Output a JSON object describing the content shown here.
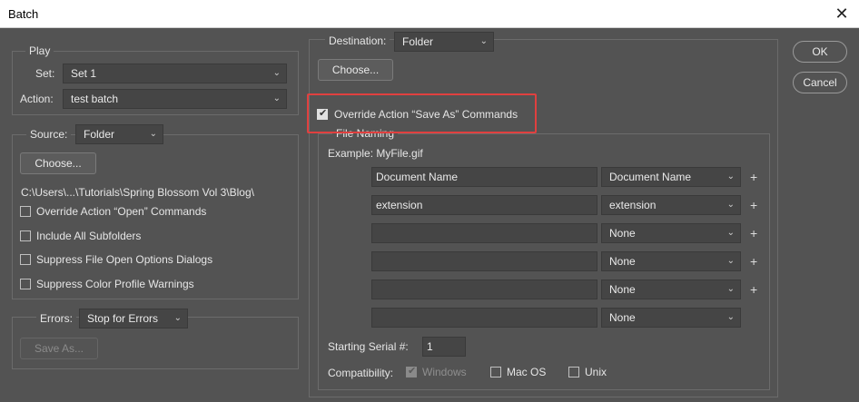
{
  "window": {
    "title": "Batch",
    "close_glyph": "✕"
  },
  "buttons": {
    "ok": "OK",
    "cancel": "Cancel"
  },
  "play": {
    "legend": "Play",
    "set_label": "Set:",
    "set_value": "Set 1",
    "action_label": "Action:",
    "action_value": "test batch"
  },
  "source": {
    "label": "Source:",
    "value": "Folder",
    "choose": "Choose...",
    "path": "C:\\Users\\...\\Tutorials\\Spring Blossom Vol 3\\Blog\\",
    "options": [
      {
        "label": "Override Action “Open” Commands",
        "checked": false
      },
      {
        "label": "Include All Subfolders",
        "checked": false
      },
      {
        "label": "Suppress File Open Options Dialogs",
        "checked": false
      },
      {
        "label": "Suppress Color Profile Warnings",
        "checked": false
      }
    ]
  },
  "errors": {
    "label": "Errors:",
    "value": "Stop for Errors",
    "save_as": "Save As..."
  },
  "destination": {
    "label": "Destination:",
    "value": "Folder",
    "choose": "Choose...",
    "override_label": "Override Action “Save As” Commands",
    "override_checked": true
  },
  "file_naming": {
    "legend": "File Naming",
    "example": "Example: MyFile.gif",
    "rows": [
      {
        "text": "Document Name",
        "select": "Document Name",
        "plus": "+"
      },
      {
        "text": "extension",
        "select": "extension",
        "plus": "+"
      },
      {
        "text": "",
        "select": "None",
        "plus": "+"
      },
      {
        "text": "",
        "select": "None",
        "plus": "+"
      },
      {
        "text": "",
        "select": "None",
        "plus": "+"
      },
      {
        "text": "",
        "select": "None",
        "plus": ""
      }
    ],
    "serial_label": "Starting Serial #:",
    "serial_value": "1",
    "compat_label": "Compatibility:",
    "compat": [
      {
        "label": "Windows",
        "checked": true,
        "disabled": true
      },
      {
        "label": "Mac OS",
        "checked": false,
        "disabled": false
      },
      {
        "label": "Unix",
        "checked": false,
        "disabled": false
      }
    ]
  },
  "icons": {
    "chevron": "chevron-down-icon",
    "check": "checkmark-icon"
  },
  "colors": {
    "background": "#535353",
    "highlight": "#e0403f"
  }
}
